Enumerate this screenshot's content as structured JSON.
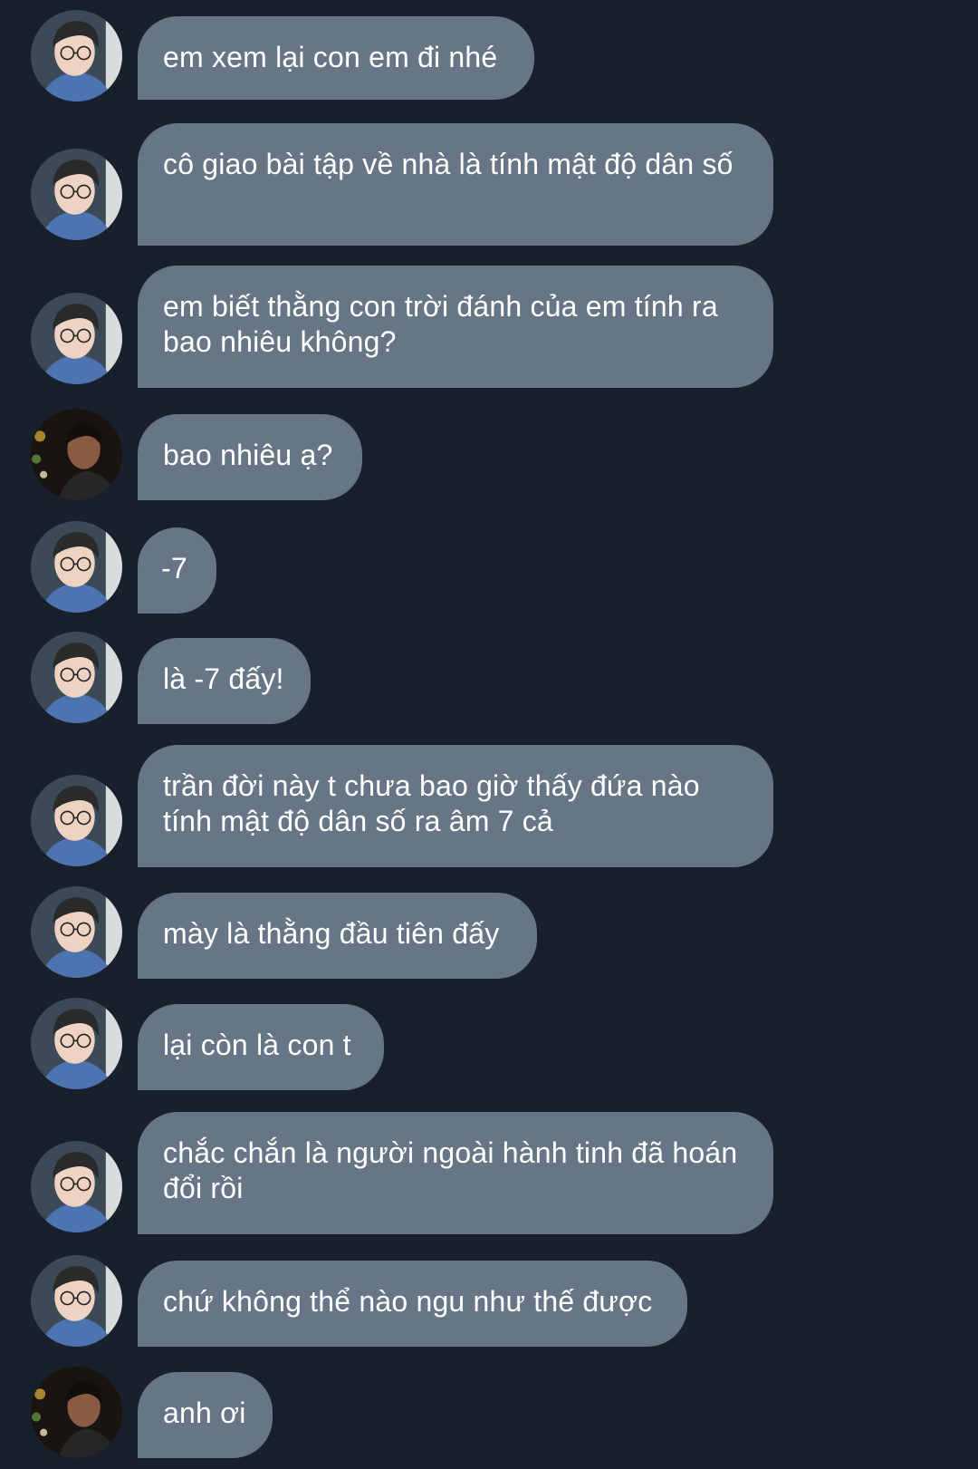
{
  "chat": {
    "messages": [
      {
        "sender": "boy-glasses",
        "avatar_icon": "avatar-boy-glasses-icon",
        "text": "em xem lại con em đi nhé"
      },
      {
        "sender": "boy-glasses",
        "avatar_icon": "avatar-boy-glasses-icon",
        "text": "cô giao bài tập về nhà là tính mật độ dân số"
      },
      {
        "sender": "boy-glasses",
        "avatar_icon": "avatar-boy-glasses-icon",
        "text": "em biết thằng con trời đánh của em tính ra bao nhiêu không?"
      },
      {
        "sender": "boy-night",
        "avatar_icon": "avatar-boy-night-icon",
        "text": "bao nhiêu ạ?"
      },
      {
        "sender": "boy-glasses",
        "avatar_icon": "avatar-boy-glasses-icon",
        "text": "-7"
      },
      {
        "sender": "boy-glasses",
        "avatar_icon": "avatar-boy-glasses-icon",
        "text": "là -7 đấy!"
      },
      {
        "sender": "boy-glasses",
        "avatar_icon": "avatar-boy-glasses-icon",
        "text": "trần đời này t chưa bao giờ thấy đứa nào tính mật độ dân số ra âm 7 cả"
      },
      {
        "sender": "boy-glasses",
        "avatar_icon": "avatar-boy-glasses-icon",
        "text": "mày là thằng đầu tiên đấy"
      },
      {
        "sender": "boy-glasses",
        "avatar_icon": "avatar-boy-glasses-icon",
        "text": "lại còn là con t"
      },
      {
        "sender": "boy-glasses",
        "avatar_icon": "avatar-boy-glasses-icon",
        "text": "chắc chắn là người ngoài hành tinh đã hoán đổi rồi"
      },
      {
        "sender": "boy-glasses",
        "avatar_icon": "avatar-boy-glasses-icon",
        "text": "chứ không thể nào ngu như thế được"
      },
      {
        "sender": "boy-night",
        "avatar_icon": "avatar-boy-night-icon",
        "text": "anh ơi"
      }
    ]
  },
  "colors": {
    "background": "#17202b",
    "bubble": "#677686",
    "text": "#ffffff"
  }
}
